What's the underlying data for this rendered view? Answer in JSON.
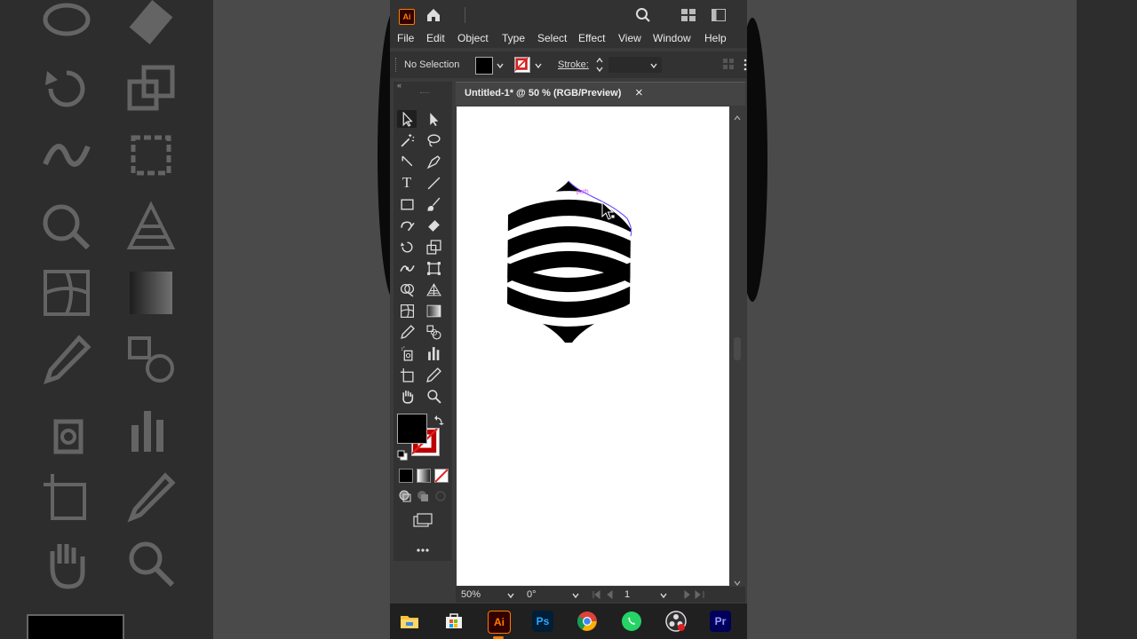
{
  "app": {
    "logo": "Ai",
    "title": "Adobe Illustrator"
  },
  "menu": [
    "File",
    "Edit",
    "Object",
    "Type",
    "Select",
    "Effect",
    "View",
    "Window",
    "Help"
  ],
  "control": {
    "selection": "No Selection",
    "stroke_label": "Stroke:"
  },
  "document": {
    "tab_title": "Untitled-1* @ 50 % (RGB/Preview)",
    "close": "×",
    "path_hint": "path"
  },
  "status": {
    "zoom": "50%",
    "rotation": "0°",
    "artboard": "1"
  },
  "taskbar": {
    "photoshop": "Ps",
    "illustrator": "Ai",
    "premiere": "Pr"
  },
  "colors": {
    "ai_orange": "#ff7c00",
    "ai_bg": "#330000",
    "ps_blue": "#31a8ff",
    "pr_purple": "#9999ff",
    "chrome_red": "#db4437",
    "whatsapp": "#25d366"
  },
  "tools": [
    "selection-tool-icon",
    "direct-selection-tool-icon",
    "magic-wand-tool-icon",
    "lasso-tool-icon",
    "pen-tool-icon",
    "curvature-tool-icon",
    "type-tool-icon",
    "line-tool-icon",
    "rectangle-tool-icon",
    "paintbrush-tool-icon",
    "shaper-tool-icon",
    "eraser-tool-icon",
    "rotate-tool-icon",
    "scale-tool-icon",
    "puppet-warp-tool-icon",
    "free-transform-tool-icon",
    "shape-builder-tool-icon",
    "perspective-grid-tool-icon",
    "mesh-tool-icon",
    "gradient-tool-icon",
    "eyedropper-tool-icon",
    "blend-tool-icon",
    "symbol-sprayer-tool-icon",
    "column-graph-tool-icon",
    "artboard-tool-icon",
    "slice-tool-icon",
    "hand-tool-icon",
    "zoom-tool-icon"
  ]
}
